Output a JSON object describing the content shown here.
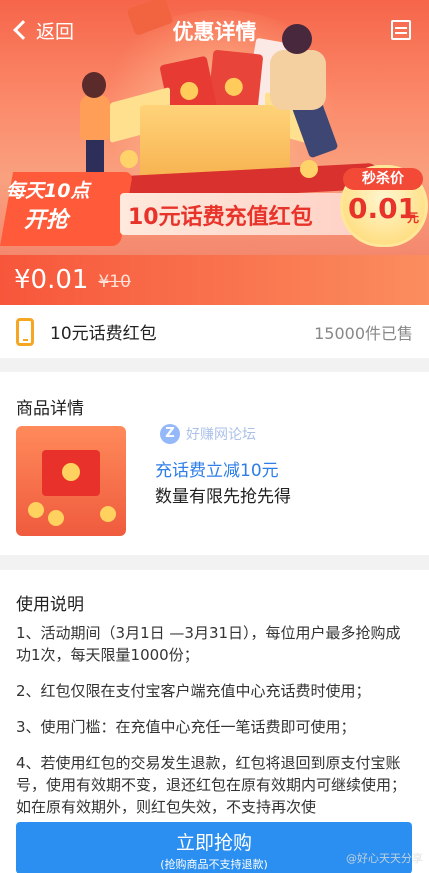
{
  "navbar": {
    "back_label": "返回",
    "title": "优惠详情"
  },
  "banner": {
    "promo_tag_line1": "每天10点",
    "promo_tag_line2": "开抢",
    "title": "10元话费充值红包",
    "badge_label": "秒杀价",
    "badge_value": "0.01",
    "badge_unit": "元"
  },
  "price": {
    "current": "¥0.01",
    "original": "¥10"
  },
  "product": {
    "name": "10元话费红包",
    "sold": "15000件已售"
  },
  "details": {
    "title": "商品详情",
    "watermark_icon": "Z",
    "watermark_text": "好赚网论坛",
    "line1": "充话费立减10元",
    "line2": "数量有限先抢先得"
  },
  "usage": {
    "title": "使用说明",
    "items": [
      "1、活动期间（3月1日 —3月31日），每位用户最多抢购成功1次，每天限量1000份；",
      "2、红包仅限在支付宝客户端充值中心充话费时使用；",
      "3、使用门槛：在充值中心充任一笔话费即可使用；",
      "4、若使用红包的交易发生退款，红包将退回到原支付宝账号，使用有效期不变，退还红包在原有效期内可继续使用；如在原有效期外，则红包失效，不支持再次使"
    ]
  },
  "buy_button": {
    "label": "立即抢购",
    "sub": "(抢购商品不支持退款)"
  },
  "weibo_watermark": "@好心天天分享",
  "colors": {
    "accent": "#f7563b",
    "button": "#2a8ff0",
    "link": "#2d7ee8"
  }
}
